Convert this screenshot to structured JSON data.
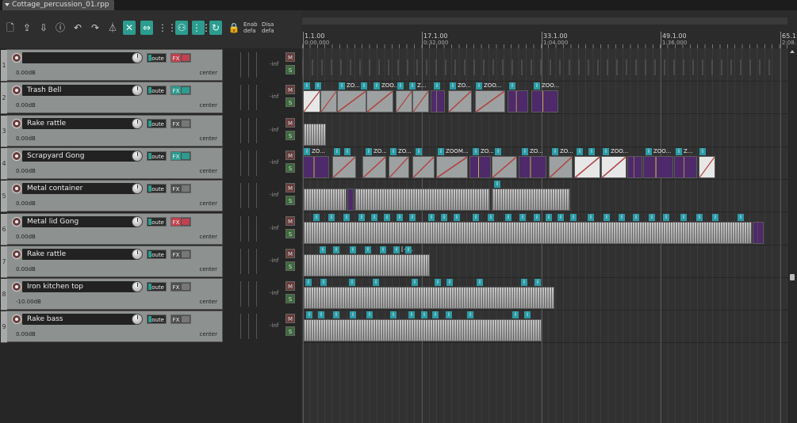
{
  "window": {
    "tab_title": "Cottage_percussion_01.rpp"
  },
  "toolbar": {
    "buttons": [
      {
        "name": "new-project-icon",
        "glyph": "🗋",
        "on": false
      },
      {
        "name": "open-project-icon",
        "glyph": "⇪",
        "on": false
      },
      {
        "name": "save-project-icon",
        "glyph": "⇩",
        "on": false
      },
      {
        "name": "project-info-icon",
        "glyph": "ⓘ",
        "on": false
      },
      {
        "name": "undo-icon",
        "glyph": "↶",
        "on": false
      },
      {
        "name": "redo-icon",
        "glyph": "↷",
        "on": false
      },
      {
        "name": "metronome-icon",
        "glyph": "⏃",
        "on": false
      },
      {
        "name": "ripple-edit-icon",
        "glyph": "✕",
        "on": true
      },
      {
        "name": "link-icon",
        "glyph": "⇔",
        "on": true
      },
      {
        "name": "grid-icon",
        "glyph": "⋮⋮",
        "on": false
      },
      {
        "name": "group-icon",
        "glyph": "⚇",
        "on": true
      },
      {
        "name": "snap-grid-icon",
        "glyph": "⋮⋮⋮",
        "on": true
      },
      {
        "name": "loop-icon",
        "glyph": "↻",
        "on": true
      },
      {
        "name": "lock-icon",
        "glyph": "🔒",
        "on": false
      }
    ],
    "enable_label_1": "Enab",
    "enable_label_2": "defa",
    "disable_label_1": "Disa",
    "disable_label_2": "defa"
  },
  "ruler": {
    "markers": [
      {
        "bar": "1.1.00",
        "time": "0:00.000"
      },
      {
        "bar": "17.1.00",
        "time": "0:32.000"
      },
      {
        "bar": "33.1.00",
        "time": "1:04.000"
      },
      {
        "bar": "49.1.00",
        "time": "1:36.000"
      },
      {
        "bar": "65.1",
        "time": "2:08."
      }
    ]
  },
  "tracks": [
    {
      "num": "1",
      "name": "",
      "vol": "0.00dB",
      "pan": "center",
      "fx": "red",
      "master": true
    },
    {
      "num": "2",
      "name": "Trash Bell",
      "vol": "0.00dB",
      "pan": "center",
      "fx": "green"
    },
    {
      "num": "3",
      "name": "Rake rattle",
      "vol": "0.00dB",
      "pan": "center",
      "fx": "off"
    },
    {
      "num": "4",
      "name": "Scrapyard Gong",
      "vol": "0.00dB",
      "pan": "center",
      "fx": "green"
    },
    {
      "num": "5",
      "name": "Metal container",
      "vol": "0.00dB",
      "pan": "center",
      "fx": "off"
    },
    {
      "num": "6",
      "name": "Metal lid Gong",
      "vol": "0.00dB",
      "pan": "center",
      "fx": "red"
    },
    {
      "num": "7",
      "name": "Rake rattle",
      "vol": "0.00dB",
      "pan": "center",
      "fx": "off"
    },
    {
      "num": "8",
      "name": "Iron kitchen top",
      "vol": "-10.00dB",
      "pan": "center",
      "fx": "off"
    },
    {
      "num": "9",
      "name": "Rake bass",
      "vol": "0.00dB",
      "pan": "center",
      "fx": "off"
    }
  ],
  "mixer": {
    "meter_value": "-inf",
    "mute_label": "M",
    "solo_label": "S",
    "route_label": "Route",
    "fx_label": "FX"
  },
  "item_labels": {
    "icon": "i",
    "zoom_short": "ZO",
    "zoom_mid": "ZOO",
    "zoom_long": "ZOOM",
    "zoom_ellipsis": "ZOOM...",
    "zoom_dotted": "ZOO...",
    "z_ellipsis": "Z...",
    "zoom_cut": "ZO...",
    "zo_item": "ZO..",
    "bracket": "[+..."
  },
  "lanes": [
    {
      "track": 2,
      "items": [
        [
          382,
          404,
          "w"
        ],
        [
          404,
          425,
          "n"
        ],
        [
          425,
          462,
          "n"
        ],
        [
          462,
          496,
          "n"
        ],
        [
          499,
          520,
          "n"
        ],
        [
          520,
          541,
          "n"
        ],
        [
          543,
          561,
          "p"
        ],
        [
          565,
          595,
          "n"
        ],
        [
          599,
          637,
          "n"
        ],
        [
          640,
          666,
          "p"
        ],
        [
          670,
          704,
          "p"
        ]
      ],
      "labels": [
        [
          383,
          "i",
          ""
        ],
        [
          397,
          "i",
          ""
        ],
        [
          427,
          "i",
          "ZO..."
        ],
        [
          455,
          "i",
          ""
        ],
        [
          471,
          "i",
          "ZOO..."
        ],
        [
          501,
          "i",
          ""
        ],
        [
          516,
          "i",
          "Z..."
        ],
        [
          547,
          "i",
          ""
        ],
        [
          567,
          "i",
          "ZO..."
        ],
        [
          600,
          "i",
          "ZOO..."
        ],
        [
          642,
          "i",
          ""
        ],
        [
          673,
          "i",
          "ZOO..."
        ]
      ]
    },
    {
      "track": 3,
      "items": [
        [
          382,
          411,
          "dense"
        ]
      ],
      "labels": []
    },
    {
      "track": 4,
      "items": [
        [
          382,
          415,
          "p"
        ],
        [
          419,
          449,
          "n"
        ],
        [
          457,
          487,
          "n"
        ],
        [
          490,
          516,
          "n"
        ],
        [
          520,
          548,
          "n"
        ],
        [
          550,
          590,
          "n"
        ],
        [
          592,
          619,
          "p"
        ],
        [
          620,
          652,
          "n"
        ],
        [
          654,
          689,
          "p"
        ],
        [
          692,
          722,
          "n"
        ],
        [
          724,
          757,
          "w"
        ],
        [
          758,
          790,
          "w"
        ],
        [
          791,
          810,
          "p"
        ],
        [
          811,
          849,
          "p"
        ],
        [
          850,
          879,
          "p"
        ],
        [
          881,
          902,
          "w"
        ]
      ],
      "labels": [
        [
          383,
          "i",
          "ZO..."
        ],
        [
          421,
          "i",
          ""
        ],
        [
          434,
          "i",
          ""
        ],
        [
          461,
          "i",
          "ZO..."
        ],
        [
          492,
          "i",
          "ZO..."
        ],
        [
          524,
          "i",
          ""
        ],
        [
          552,
          "i",
          "ZOOM..."
        ],
        [
          596,
          "i",
          "ZO..."
        ],
        [
          624,
          "i",
          ""
        ],
        [
          658,
          "i",
          "ZO..."
        ],
        [
          696,
          "i",
          "ZO..."
        ],
        [
          727,
          "i",
          ""
        ],
        [
          742,
          "i",
          ""
        ],
        [
          760,
          "i",
          "ZOO..."
        ],
        [
          814,
          "i",
          "ZOO..."
        ],
        [
          852,
          "i",
          "Z..."
        ],
        [
          882,
          "i",
          ""
        ]
      ]
    },
    {
      "track": 5,
      "items": [
        [
          382,
          437,
          "dense"
        ],
        [
          438,
          446,
          "p"
        ],
        [
          447,
          618,
          "dense"
        ],
        [
          620,
          719,
          "dense"
        ]
      ],
      "labels": [
        [
          623,
          "i",
          ""
        ]
      ]
    },
    {
      "track": 6,
      "items": [
        [
          382,
          948,
          "dense"
        ],
        [
          949,
          963,
          "p"
        ]
      ],
      "labels": [
        [
          395,
          "i",
          ""
        ],
        [
          414,
          "i",
          ""
        ],
        [
          433,
          "i",
          ""
        ],
        [
          452,
          "i",
          ""
        ],
        [
          468,
          "i",
          ""
        ],
        [
          484,
          "i",
          ""
        ],
        [
          500,
          "i",
          ""
        ],
        [
          516,
          "i",
          ""
        ],
        [
          540,
          "i",
          ""
        ],
        [
          556,
          "i",
          ""
        ],
        [
          572,
          "i",
          ""
        ],
        [
          596,
          "i",
          ""
        ],
        [
          615,
          "i",
          ""
        ],
        [
          637,
          "i",
          ""
        ],
        [
          655,
          "i",
          ""
        ],
        [
          673,
          "i",
          ""
        ],
        [
          688,
          "i",
          ""
        ],
        [
          703,
          "i",
          ""
        ],
        [
          719,
          "i",
          ""
        ],
        [
          741,
          "i",
          ""
        ],
        [
          761,
          "i",
          ""
        ],
        [
          780,
          "i",
          ""
        ],
        [
          798,
          "i",
          ""
        ],
        [
          818,
          "i",
          ""
        ],
        [
          836,
          "i",
          ""
        ],
        [
          858,
          "i",
          ""
        ],
        [
          878,
          "i",
          ""
        ],
        [
          898,
          "i",
          ""
        ],
        [
          930,
          "i",
          ""
        ]
      ]
    },
    {
      "track": 7,
      "items": [
        [
          382,
          542,
          "dense"
        ]
      ],
      "labels": [
        [
          403,
          "i",
          ""
        ],
        [
          420,
          "i",
          ""
        ],
        [
          441,
          "i",
          ""
        ],
        [
          460,
          "i",
          ""
        ],
        [
          479,
          "i",
          ""
        ],
        [
          496,
          "i",
          "[+..."
        ],
        [
          511,
          "i",
          ""
        ]
      ]
    },
    {
      "track": 8,
      "items": [
        [
          382,
          699,
          "dense"
        ]
      ],
      "labels": [
        [
          385,
          "i",
          ""
        ],
        [
          404,
          "i",
          ""
        ],
        [
          440,
          "i",
          ""
        ],
        [
          470,
          "i",
          ""
        ],
        [
          519,
          "i",
          ""
        ],
        [
          548,
          "i",
          ""
        ],
        [
          563,
          "i",
          ""
        ],
        [
          601,
          "i",
          ""
        ],
        [
          657,
          "i",
          ""
        ],
        [
          674,
          "i",
          ""
        ]
      ]
    },
    {
      "track": 9,
      "items": [
        [
          382,
          683,
          "dense"
        ]
      ],
      "labels": [
        [
          386,
          "i",
          ""
        ],
        [
          401,
          "i",
          ""
        ],
        [
          420,
          "i",
          ""
        ],
        [
          441,
          "i",
          ""
        ],
        [
          462,
          "i",
          ""
        ],
        [
          492,
          "i",
          ""
        ],
        [
          515,
          "i",
          ""
        ],
        [
          531,
          "i",
          ""
        ],
        [
          545,
          "i",
          ""
        ],
        [
          562,
          "i",
          ""
        ],
        [
          589,
          "i",
          ""
        ],
        [
          646,
          "i",
          ""
        ],
        [
          661,
          "i",
          ""
        ]
      ]
    }
  ]
}
